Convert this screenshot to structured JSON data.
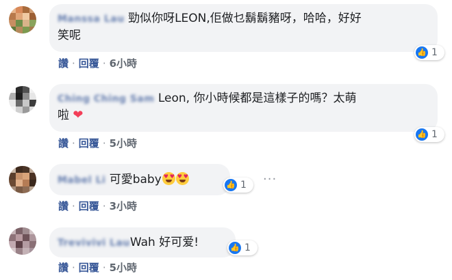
{
  "comments": [
    {
      "name": "Manssa Lau",
      "text_line1": "勁似你呀LEON,佢做乜鬍鬍豬呀，哈哈，好好",
      "text_line2": "笑呢",
      "reactions": "1",
      "actions": {
        "like": "讚",
        "reply": "回覆",
        "time": "6小時"
      }
    },
    {
      "name": "Ching Ching Sam",
      "text_line1": "Leon, 你小時候都是這樣子的嗎？太萌",
      "text_line2": "啦",
      "reactions": "1",
      "actions": {
        "like": "讚",
        "reply": "回覆",
        "time": "5小時"
      }
    },
    {
      "name": "Mabel Li",
      "text_line1": "可愛baby",
      "reactions": "1",
      "actions": {
        "like": "讚",
        "reply": "回覆",
        "time": "3小時"
      }
    },
    {
      "name": "Trevivivi Lau",
      "text_line1": "Wah 好可爱!",
      "reactions": "1",
      "actions": {
        "like": "讚",
        "reply": "回覆",
        "time": "5小時"
      }
    }
  ],
  "more_options": "···",
  "icons": {
    "like": "like-icon",
    "heart": "heart-icon",
    "emoji": "heart-eyes-emoji-icon"
  },
  "colors": {
    "link": "#385898",
    "bubble": "#f2f3f5",
    "like": "#1877f2",
    "heart": "#f33e58"
  }
}
